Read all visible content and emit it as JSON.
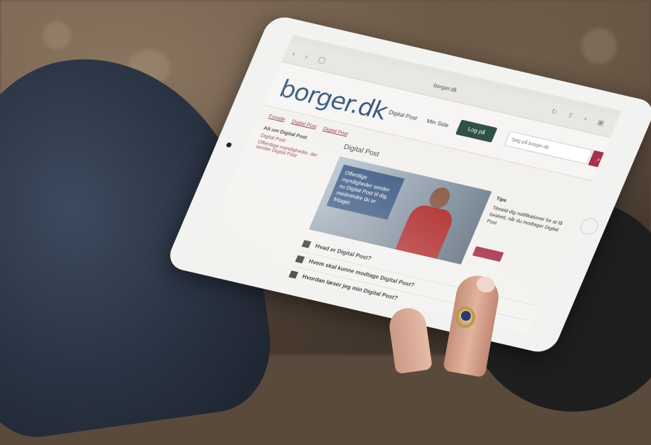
{
  "browser": {
    "url": "borger.dk",
    "nav_icons": [
      "back-icon",
      "forward-icon",
      "bookmarks-icon"
    ],
    "tool_icons": [
      "reload-icon",
      "share-icon",
      "new-tab-icon",
      "tabs-icon"
    ]
  },
  "header": {
    "logo": "borger.dk",
    "nav_1": "Digital Post",
    "nav_2": "Min Side",
    "login_label": "Log på",
    "search_placeholder": "Søg på borger.dk",
    "search_icon": "search-icon"
  },
  "breadcrumb": {
    "item_1": "Forside",
    "item_2": "Digital Post",
    "item_3": "Digital Post"
  },
  "sidebar": {
    "title": "Alt om Digital Post",
    "item_1": "Digital Post",
    "item_2": "Offentlige myndigheder, der sender Digital Post"
  },
  "main": {
    "page_title": "Digital Post",
    "hero_text": "Offentlige myndigheder sender nu Digital Post til dig, medmindre du er fritaget",
    "aside_title": "Tips",
    "aside_text": "Tilmeld dig notifikationer for at få besked, når du modtager Digital Post",
    "links": [
      "Hvad er Digital Post?",
      "Hvem skal kunne modtage Digital Post?",
      "Hvordan læser jeg min Digital Post?"
    ]
  },
  "colors": {
    "brand": "#3b5a82",
    "accent": "#a8304a",
    "login": "#2f5244"
  }
}
